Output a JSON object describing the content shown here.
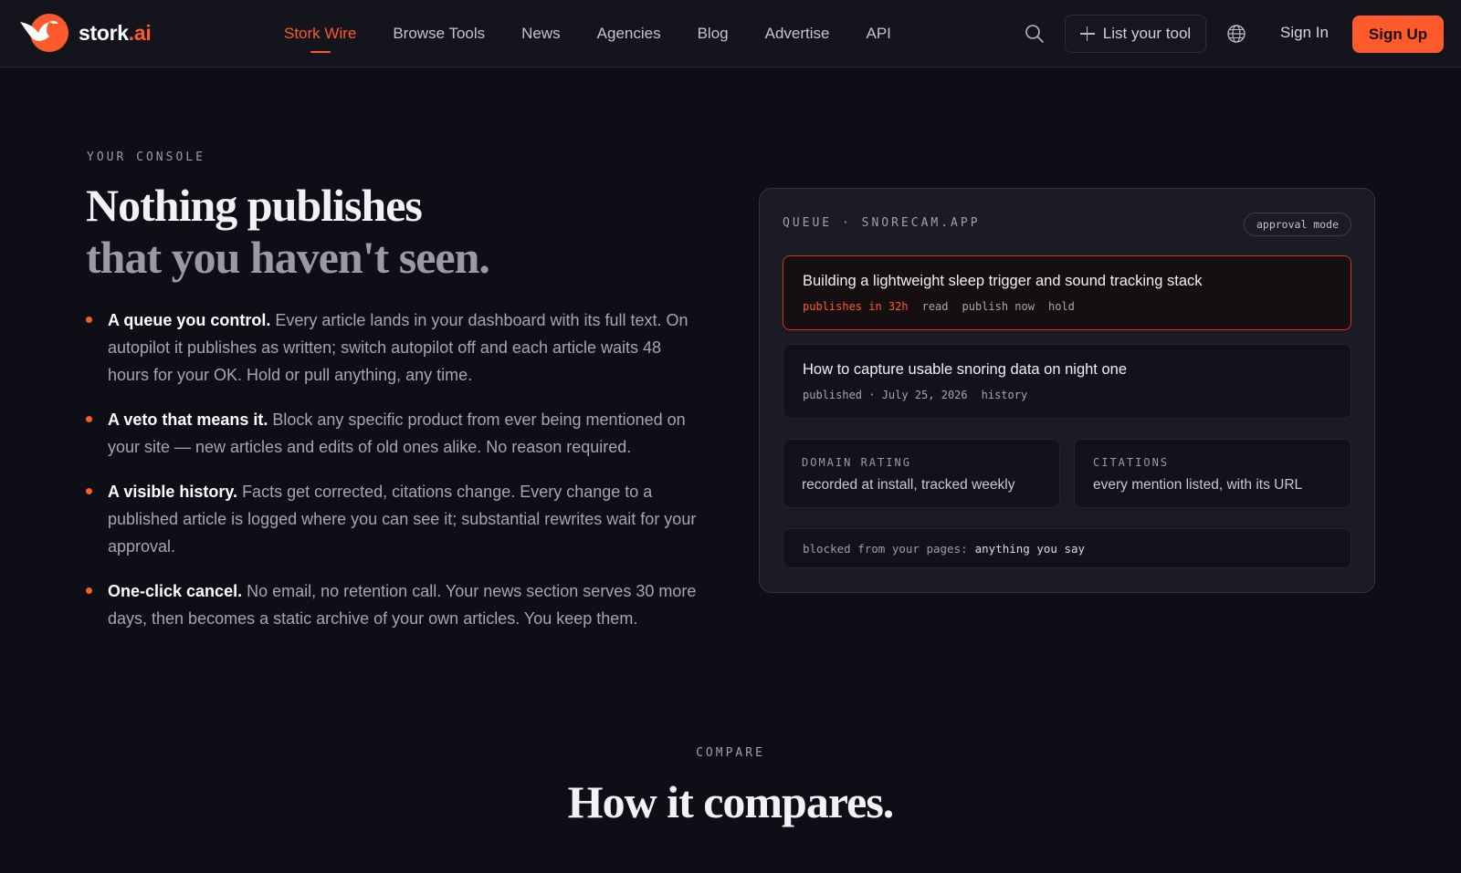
{
  "brand": {
    "name": "stork",
    "suffix": ".ai",
    "accent_color": "#ff5a2c"
  },
  "nav": {
    "links": [
      {
        "label": "Stork Wire",
        "active": true
      },
      {
        "label": "Browse Tools",
        "active": false
      },
      {
        "label": "News",
        "active": false
      },
      {
        "label": "Agencies",
        "active": false
      },
      {
        "label": "Blog",
        "active": false
      },
      {
        "label": "Advertise",
        "active": false
      },
      {
        "label": "API",
        "active": false
      }
    ],
    "list_tool": "List your tool",
    "sign_in": "Sign In",
    "sign_up": "Sign Up"
  },
  "console": {
    "eyebrow": "YOUR CONSOLE",
    "headline_1": "Nothing publishes",
    "headline_2": "that you haven't seen.",
    "bullets": [
      {
        "lead": "A queue you control.",
        "text": "Every article lands in your dashboard with its full text. On autopilot it publishes as written; switch autopilot off and each article waits 48 hours for your OK. Hold or pull anything, any time."
      },
      {
        "lead": "A veto that means it.",
        "text": "Block any specific product from ever being mentioned on your site — new articles and edits of old ones alike. No reason required."
      },
      {
        "lead": "A visible history.",
        "text": "Facts get corrected, citations change. Every change to a published article is logged where you can see it; substantial rewrites wait for your approval."
      },
      {
        "lead": "One-click cancel.",
        "text": "No email, no retention call. Your news section serves 30 more days, then becomes a static archive of your own articles. You keep them."
      }
    ]
  },
  "queue_card": {
    "title": "QUEUE · SNORECAM.APP",
    "mode": "approval mode",
    "items": [
      {
        "title": "Building a lightweight sleep trigger and sound tracking stack",
        "status": "publishes in 32h",
        "actions": [
          "read",
          "publish now",
          "hold"
        ]
      },
      {
        "title": "How to capture usable snoring data on night one",
        "status": "published · July 25, 2026",
        "actions": [
          "history"
        ]
      }
    ],
    "stats": [
      {
        "label": "DOMAIN RATING",
        "value": "recorded at install, tracked weekly"
      },
      {
        "label": "CITATIONS",
        "value": "every mention listed, with its URL"
      }
    ],
    "blocked_label": "blocked from your pages:",
    "blocked_value": "anything you say"
  },
  "compare": {
    "eyebrow": "COMPARE",
    "title": "How it compares."
  }
}
